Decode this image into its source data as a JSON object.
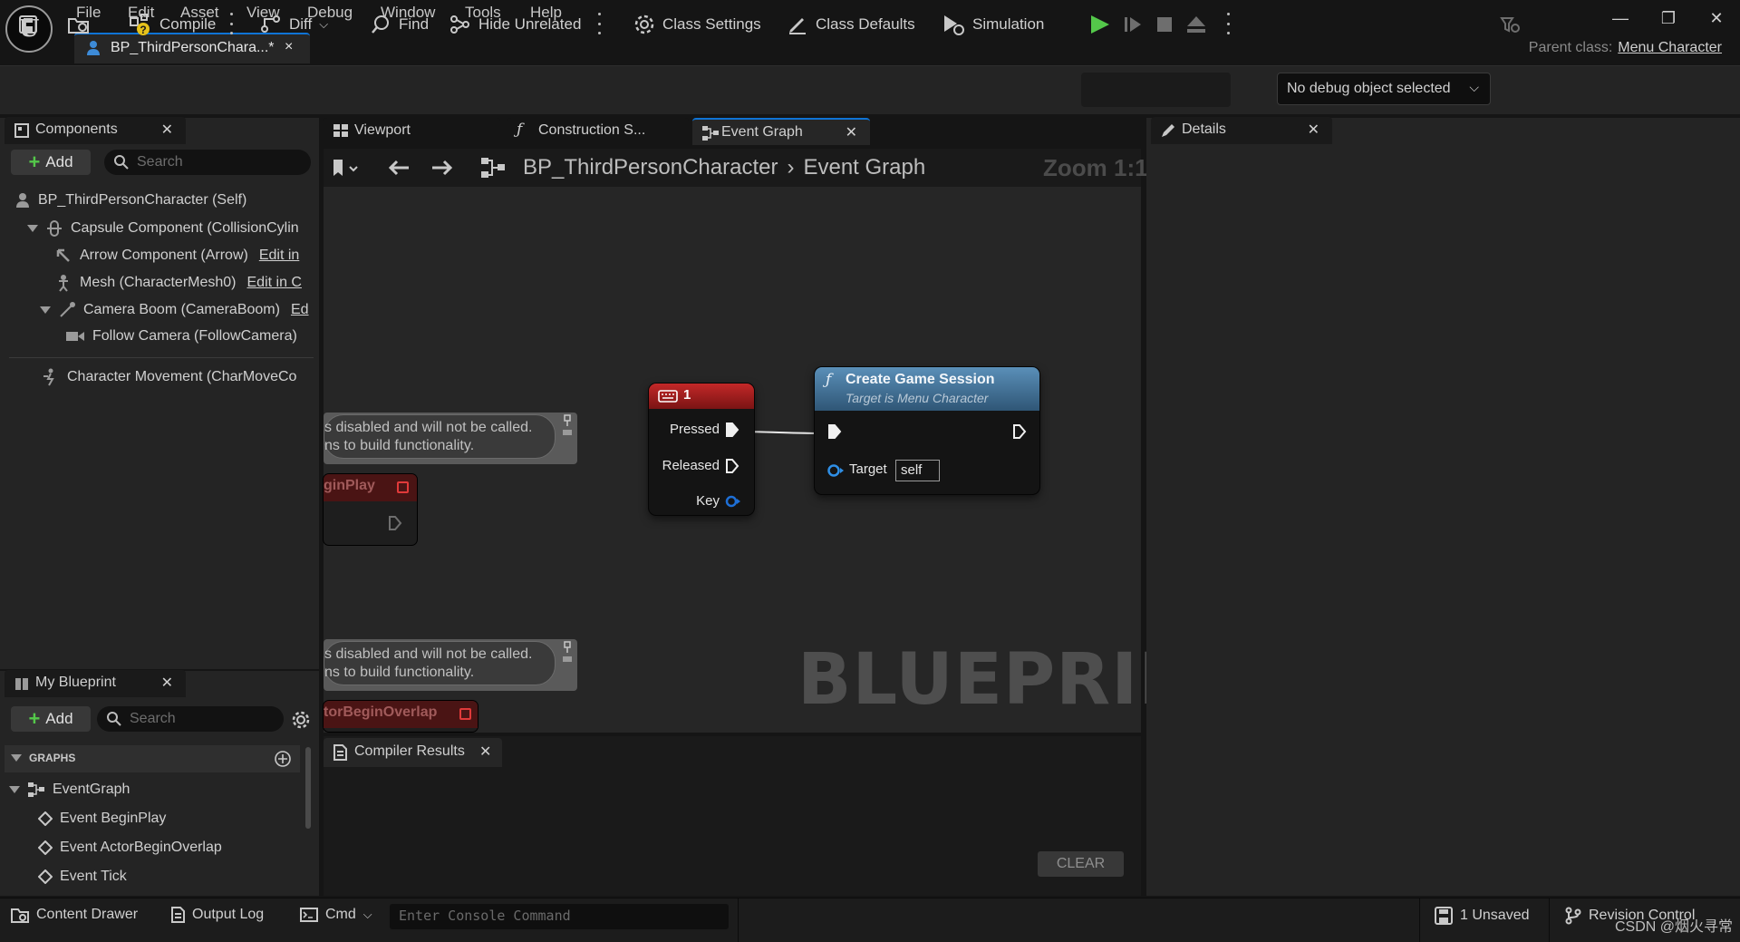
{
  "app": {
    "logo_text": "U"
  },
  "menu": [
    "File",
    "Edit",
    "Asset",
    "View",
    "Debug",
    "Window",
    "Tools",
    "Help"
  ],
  "asset_tab": {
    "label": "BP_ThirdPersonChara...*",
    "close": "×"
  },
  "parent_class": {
    "label": "Parent class:",
    "value": "Menu Character"
  },
  "toolbar": {
    "compile": "Compile",
    "diff": "Diff",
    "find": "Find",
    "hide_unrelated": "Hide Unrelated",
    "class_settings": "Class Settings",
    "class_defaults": "Class Defaults",
    "simulation": "Simulation",
    "debug_object": "No debug object selected"
  },
  "components_panel": {
    "title": "Components",
    "add": "Add",
    "search_placeholder": "Search",
    "items": [
      {
        "label": "BP_ThirdPersonCharacter (Self)",
        "edit": ""
      },
      {
        "label": "Capsule Component (CollisionCylin",
        "edit": ""
      },
      {
        "label": "Arrow Component (Arrow)",
        "edit": "Edit in"
      },
      {
        "label": "Mesh (CharacterMesh0)",
        "edit": "Edit in C"
      },
      {
        "label": "Camera Boom (CameraBoom)",
        "edit": "Ed"
      },
      {
        "label": "Follow Camera (FollowCamera)",
        "edit": ""
      },
      {
        "label": "Character Movement (CharMoveCo",
        "edit": ""
      }
    ]
  },
  "my_blueprint": {
    "title": "My Blueprint",
    "add": "Add",
    "search_placeholder": "Search",
    "section": "GRAPHS",
    "graph": "EventGraph",
    "events": [
      "Event BeginPlay",
      "Event ActorBeginOverlap",
      "Event Tick"
    ]
  },
  "editor_tabs": {
    "viewport": "Viewport",
    "construction": "Construction S...",
    "event_graph": "Event Graph"
  },
  "graph": {
    "breadcrumb_root": "BP_ThirdPersonCharacter",
    "breadcrumb_sep": "›",
    "breadcrumb_leaf": "Event Graph",
    "zoom": "Zoom 1:1",
    "watermark": "BLUEPRINT",
    "comment_line1": "s disabled and will not be called.",
    "comment_line2": "ns to build functionality.",
    "ghost1": "ginPlay",
    "ghost2": "torBeginOverlap",
    "key_node": {
      "title": "1",
      "pins": [
        "Pressed",
        "Released",
        "Key"
      ]
    },
    "func_node": {
      "title": "Create Game Session",
      "subtitle": "Target is Menu Character",
      "target_label": "Target",
      "target_value": "self"
    }
  },
  "details_panel": {
    "title": "Details"
  },
  "compiler": {
    "title": "Compiler Results",
    "clear": "CLEAR"
  },
  "statusbar": {
    "content_drawer": "Content Drawer",
    "output_log": "Output Log",
    "cmd": "Cmd",
    "console_placeholder": "Enter Console Command",
    "unsaved": "1 Unsaved",
    "revision_control": "Revision Control",
    "watermark_text": "CSDN @烟火寻常"
  },
  "colors": {
    "accent_blue": "#0f74d6",
    "play_green": "#54c84a",
    "event_red": "#a41d1d",
    "func_blue": "#4f7fa6"
  }
}
